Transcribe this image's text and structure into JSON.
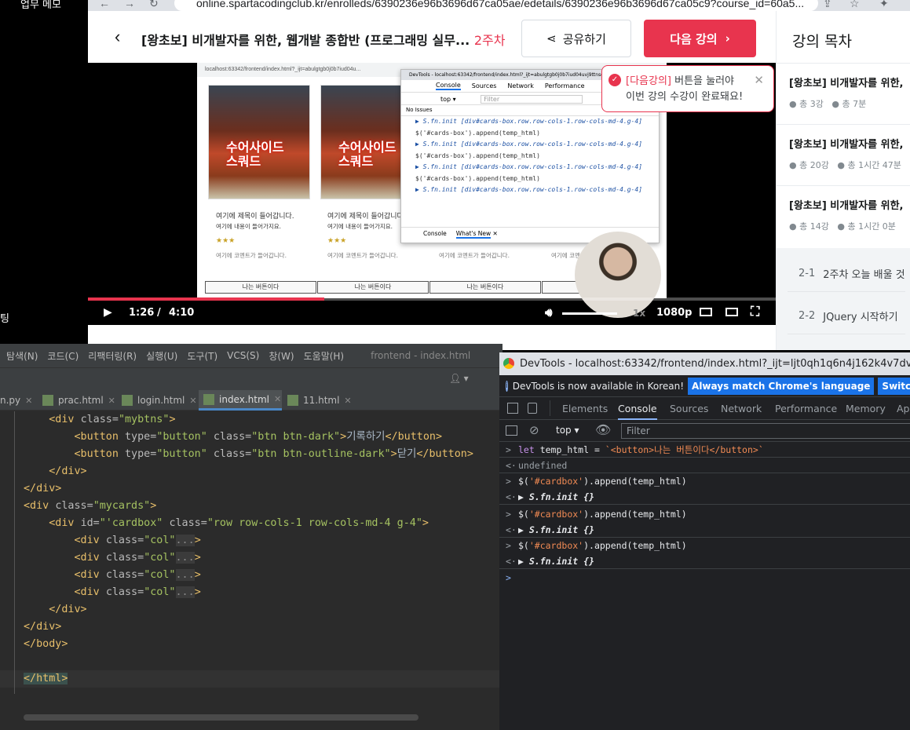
{
  "desktop": {
    "label_top": "업무 메모",
    "label_side": "팅"
  },
  "browser": {
    "url": "online.spartacodingclub.kr/enrolleds/6390236e96b3696d67ca05ae/edetails/6390236e96b3696d67ca05c9?course_id=60a5..."
  },
  "course_header": {
    "title": "[왕초보] 비개발자를 위한, 웹개발 종합반 (프로그래밍 실무...",
    "week": "2주차",
    "share_label": "공유하기",
    "next_label": "다음 강의"
  },
  "tooltip": {
    "highlight": "[다음강의]",
    "line1_rest": " 버튼을 눌러야",
    "line2": "이번 강의 수강이 완료돼요!"
  },
  "side_panel": {
    "title": "강의 목차",
    "courses": [
      {
        "title": "[왕초보] 비개발자를 위한,",
        "count": "총 3강",
        "time": "총 7분"
      },
      {
        "title": "[왕초보] 비개발자를 위한,",
        "count": "총 20강",
        "time": "총 1시간 47분"
      },
      {
        "title": "[왕초보] 비개발자를 위한,",
        "count": "총 14강",
        "time": "총 1시간 0분"
      }
    ],
    "lessons": [
      {
        "num": "2-1",
        "title": "2주차 오늘 배울 것"
      },
      {
        "num": "2-2",
        "title": "JQuery 시작하기"
      }
    ]
  },
  "video": {
    "current_time": "1:26",
    "separator": "/",
    "duration": "4:10",
    "speed": "1x",
    "quality": "1080p",
    "progress": 0.344,
    "frame": {
      "url": "localhost:63342/frontend/index.html?_ijt=abulgtgb0j0b7iud04u...",
      "poster_text_l1": "수어사이드",
      "poster_text_l2": "스쿼드",
      "card_title": "여기에 제목이 들어갑니다.",
      "card_body": "여기에 내용이 들어가지요.",
      "card_stars": "★★★",
      "card_comment": "여기에 코멘트가 들어갑니다.",
      "btn_label": "나는 버튼이다",
      "mini_dt": {
        "title": "DevTools - localhost:63342/frontend/index.html?_ijt=abulgtgb0j0b7iud04uvj9ttnse",
        "tabs": [
          "Console",
          "Sources",
          "Network",
          "Performance"
        ],
        "filter": "Filter",
        "top": "top",
        "issues": "No Issues",
        "lines": [
          "▶ S.fn.init [div#cards-box.row.row-cols-1.row-cols-md-4.g-4]",
          "$('#cards-box').append(temp_html)",
          "▶ S.fn.init [div#cards-box.row.row-cols-1.row-cols-md-4.g-4]",
          "$('#cards-box').append(temp_html)",
          "▶ S.fn.init [div#cards-box.row.row-cols-1.row-cols-md-4.g-4]",
          "$('#cards-box').append(temp_html)",
          "▶ S.fn.init [div#cards-box.row.row-cols-1.row-cols-md-4.g-4]"
        ],
        "bottom_tabs": [
          "Console",
          "What's New"
        ]
      }
    }
  },
  "ide": {
    "menu": [
      "탐색(N)",
      "코드(C)",
      "리팩터링(R)",
      "실행(U)",
      "도구(T)",
      "VCS(S)",
      "창(W)",
      "도움말(H)"
    ],
    "window_title": "frontend - index.html",
    "tabs": [
      "n.py",
      "prac.html",
      "login.html",
      "index.html",
      "11.html"
    ],
    "active_tab": "index.html"
  },
  "devtools": {
    "title": "DevTools - localhost:63342/frontend/index.html?_ijt=ljt0qh1q6n4j162k4v7dvh2bjo&_ij_reload",
    "info": "DevTools is now available in Korean!",
    "btn_match": "Always match Chrome's language",
    "btn_switch": "Switch DevTools to",
    "tabs": [
      "Elements",
      "Console",
      "Sources",
      "Network",
      "Performance",
      "Memory",
      "Ap"
    ],
    "top_label": "top",
    "filter_placeholder": "Filter",
    "undefined": "undefined",
    "fn_init": "S.fn.init {}"
  },
  "colors": {
    "accent": "#e8344e",
    "ide_bg": "#2b2b2b",
    "devtools_bg": "#202124"
  }
}
